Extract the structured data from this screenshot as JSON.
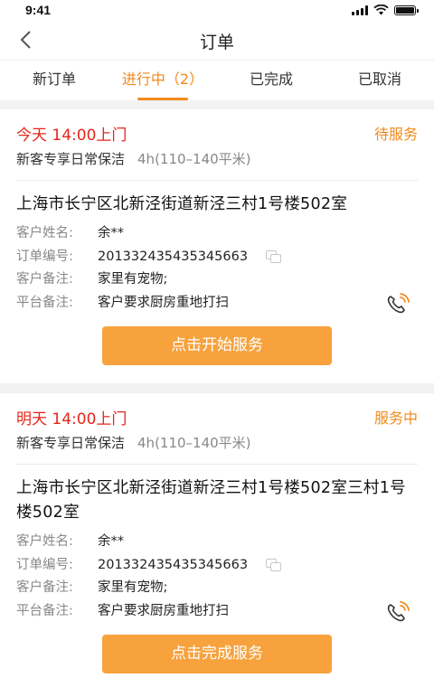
{
  "status_bar": {
    "time": "9:41",
    "battery_level": 1.0
  },
  "nav": {
    "title": "订单",
    "back_icon": "chevron-left-icon"
  },
  "tabs": [
    {
      "label": "新订单",
      "active": false
    },
    {
      "label": "进行中（2）",
      "active": true
    },
    {
      "label": "已完成",
      "active": false
    },
    {
      "label": "已取消",
      "active": false
    }
  ],
  "orders": [
    {
      "schedule": "今天 14:00上门",
      "status": "待服务",
      "service": "新客专享日常保洁",
      "duration": "4h(110–140平米)",
      "address": "上海市长宁区北新泾街道新泾三村1号楼502室",
      "customer_label": "客户姓名:",
      "customer_value": "余**",
      "order_no_label": "订单编号:",
      "order_no_value": "201332435435345663",
      "customer_note_label": "客户备注:",
      "customer_note_value": "家里有宠物;",
      "platform_note_label": "平台备注:",
      "platform_note_value": "客户要求厨房重地打扫",
      "action_label": "点击开始服务"
    },
    {
      "schedule": "明天 14:00上门",
      "status": "服务中",
      "service": "新客专享日常保洁",
      "duration": "4h(110–140平米)",
      "address": "上海市长宁区北新泾街道新泾三村1号楼502室三村1号楼502室",
      "customer_label": "客户姓名:",
      "customer_value": "余**",
      "order_no_label": "订单编号:",
      "order_no_value": "201332435435345663",
      "customer_note_label": "客户备注:",
      "customer_note_value": "家里有宠物;",
      "platform_note_label": "平台备注:",
      "platform_note_value": "客户要求厨房重地打扫",
      "action_label": "点击完成服务"
    }
  ],
  "colors": {
    "accent": "#f28a1d",
    "button": "#f7a23d",
    "schedule": "#e6251b"
  }
}
